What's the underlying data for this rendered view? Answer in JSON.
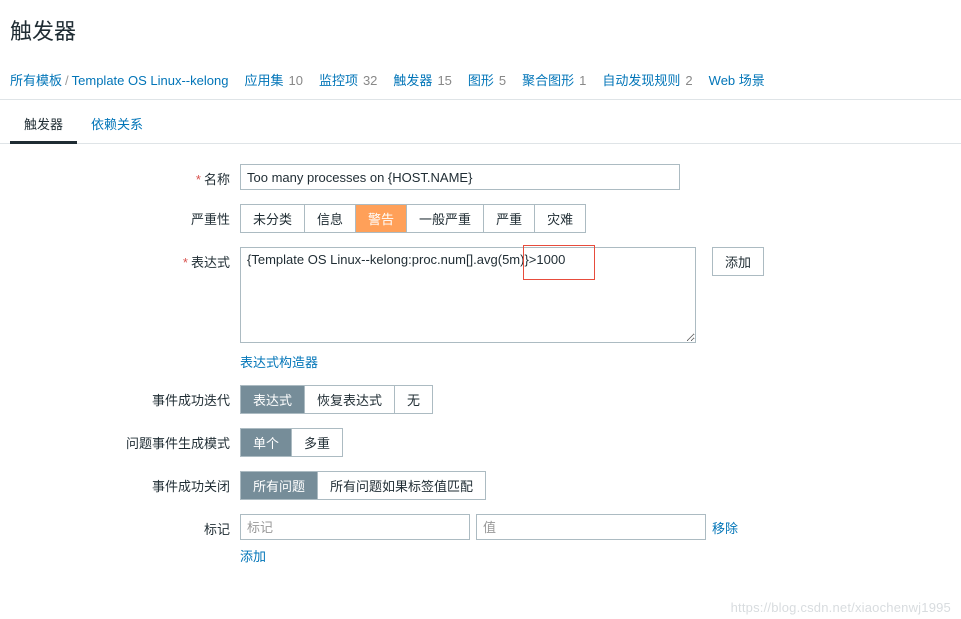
{
  "page": {
    "title": "触发器"
  },
  "breadcrumb": {
    "all_templates": "所有模板",
    "template_name": "Template OS Linux--kelong",
    "items": [
      {
        "label": "应用集",
        "count": "10"
      },
      {
        "label": "监控项",
        "count": "32"
      },
      {
        "label": "触发器",
        "count": "15"
      },
      {
        "label": "图形",
        "count": "5"
      },
      {
        "label": "聚合图形",
        "count": "1"
      },
      {
        "label": "自动发现规则",
        "count": "2"
      },
      {
        "label": "Web 场景",
        "count": ""
      }
    ]
  },
  "tabs": {
    "trigger": "触发器",
    "deps": "依赖关系"
  },
  "form": {
    "name_label": "名称",
    "name_value": "Too many processes on {HOST.NAME}",
    "severity_label": "严重性",
    "severity_opts": [
      "未分类",
      "信息",
      "警告",
      "一般严重",
      "严重",
      "灾难"
    ],
    "expression_label": "表达式",
    "expression_value": "{Template OS Linux--kelong:proc.num[].avg(5m)}>1000",
    "add_btn": "添加",
    "expr_builder": "表达式构造器",
    "event_iter_label": "事件成功迭代",
    "event_iter_opts": [
      "表达式",
      "恢复表达式",
      "无"
    ],
    "problem_mode_label": "问题事件生成模式",
    "problem_mode_opts": [
      "单个",
      "多重"
    ],
    "event_close_label": "事件成功关闭",
    "event_close_opts": [
      "所有问题",
      "所有问题如果标签值匹配"
    ],
    "tags_label": "标记",
    "tag_placeholder": "标记",
    "value_placeholder": "值",
    "remove": "移除",
    "add_link": "添加"
  },
  "watermark": "https://blog.csdn.net/xiaochenwj1995"
}
